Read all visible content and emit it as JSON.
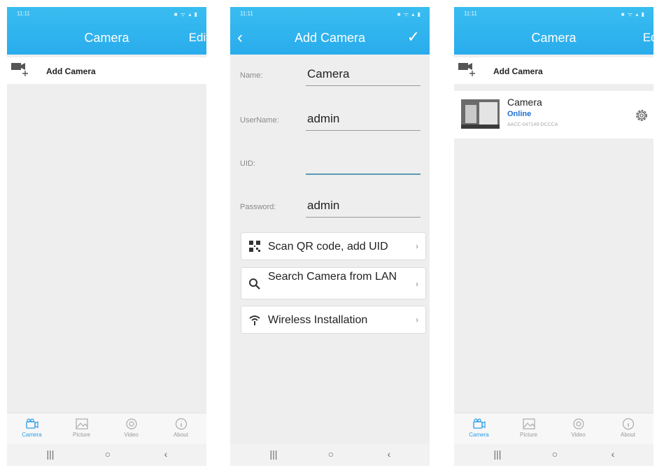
{
  "status": {
    "time": "11:11",
    "icons": "■ ᯤ ▴ ▮"
  },
  "screen1": {
    "title": "Camera",
    "edit": "Edit",
    "add_label": "Add Camera"
  },
  "screen2": {
    "title": "Add Camera",
    "fields": [
      {
        "label": "Name:",
        "value": "Camera"
      },
      {
        "label": "UserName:",
        "value": "admin"
      },
      {
        "label": "UID:",
        "value": ""
      },
      {
        "label": "Password:",
        "value": "admin"
      }
    ],
    "actions": [
      {
        "label": "Scan QR code, add UID",
        "icon": "qr-code-icon"
      },
      {
        "label": "Search Camera from LAN",
        "icon": "search-icon"
      },
      {
        "label": "Wireless Installation",
        "icon": "wifi-icon"
      }
    ]
  },
  "screen3": {
    "title": "Camera",
    "edit": "Edit",
    "add_label": "Add Camera",
    "device": {
      "name": "Camera",
      "status": "Online",
      "uid": "AACC-047149-DCCCA"
    }
  },
  "tabs": [
    {
      "label": "Camera",
      "icon": "camera-icon"
    },
    {
      "label": "Picture",
      "icon": "picture-icon"
    },
    {
      "label": "Video",
      "icon": "video-icon"
    },
    {
      "label": "About",
      "icon": "info-icon"
    }
  ],
  "colors": {
    "header": "#29acec",
    "active_tab": "#2a9de8",
    "online": "#1f6fd1"
  }
}
